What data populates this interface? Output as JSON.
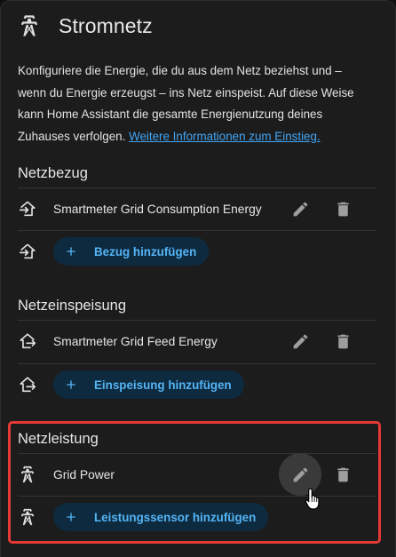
{
  "header": {
    "title": "Stromnetz",
    "icon": "transmission-tower-icon"
  },
  "description": {
    "text": "Konfiguriere die Energie, die du aus dem Netz beziehst und – wenn du Energie erzeugst – ins Netz einspeist. Auf diese Weise kann Home Assistant die gesamte Energienutzung deines Zuhauses verfolgen. ",
    "link": "Weitere Informationen zum Einstieg."
  },
  "sections": {
    "consumption": {
      "title": "Netzbezug",
      "item": "Smartmeter Grid Consumption Energy",
      "add_label": "Bezug hinzufügen",
      "icon": "transmission-tower-import-icon"
    },
    "feed": {
      "title": "Netzeinspeisung",
      "item": "Smartmeter Grid Feed Energy",
      "add_label": "Einspeisung hinzufügen",
      "icon": "transmission-tower-export-icon"
    },
    "power": {
      "title": "Netzleistung",
      "item": "Grid Power",
      "add_label": "Leistungssensor hinzufügen",
      "icon": "transmission-tower-icon"
    }
  },
  "colors": {
    "background": "#1c1c1c",
    "accent": "#54b4f5",
    "link": "#42a5f5",
    "button_bg": "#0e2a3f",
    "highlight": "#e53935"
  }
}
